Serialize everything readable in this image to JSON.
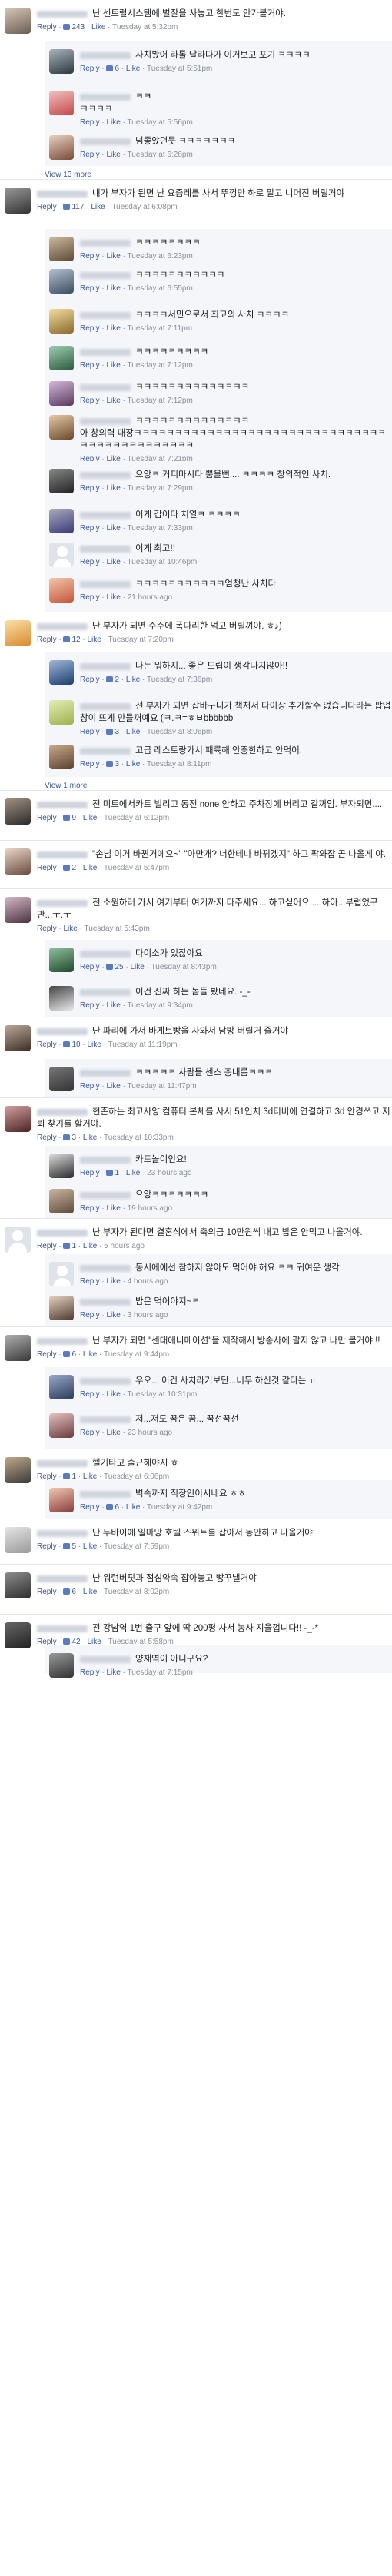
{
  "comments": [
    {
      "level": 0,
      "text": "난 센트럴시스템에 별잘을 사놓고 한번도 안가볼거야.",
      "likes": "243",
      "time": "Tuesday at 5:32pm",
      "h": 54,
      "av": [
        "#6b5d55",
        "#d8c7b5"
      ]
    },
    {
      "level": 1,
      "text": "사치봤어 라톨 달라다가 이거보고 포기 ㅋㅋㅋㅋ",
      "likes": "6",
      "time": "Tuesday at 5:51pm",
      "h": 54,
      "av": [
        "#2c3740",
        "#a8b3ba"
      ]
    },
    {
      "level": 1,
      "text": "ㅋㅋ\nㅋㅋㅋㅋ",
      "likes": "",
      "time": "Tuesday at 5:56pm",
      "h": 58,
      "av": [
        "#c44a4a",
        "#f0c0c0"
      ]
    },
    {
      "level": 1,
      "text": "넘좋았던뭇 ㅋㅋㅋㅋㅋㅋㅋ",
      "likes": "",
      "time": "Tuesday at 6:26pm",
      "h": 50,
      "av": [
        "#7a4b3a",
        "#e8d0c0"
      ]
    },
    {
      "type": "more",
      "text": "View 13 more"
    },
    {
      "level": 0,
      "text": "내가 부자가 된면 난 요즘레를 사서 뚜껑만 하로 말고 니머진 버릴거야",
      "likes": "117",
      "time": "Tuesday at 6:08pm",
      "h": 64,
      "av": [
        "#333",
        "#999"
      ]
    },
    {
      "level": 1,
      "text": "ㅋㅋㅋㅋㅋㅋㅋㅋ",
      "likes": "",
      "time": "Tuesday at 6:23pm",
      "h": 42,
      "av": [
        "#5c4a38",
        "#cdb99c"
      ]
    },
    {
      "level": 1,
      "text": "ㅋㅋㅋㅋㅋㅋㅋㅋㅋㅋㅋ",
      "likes": "",
      "time": "Tuesday at 6:55pm",
      "h": 52,
      "av": [
        "#3d4f63",
        "#b2c0cf"
      ]
    },
    {
      "level": 1,
      "text": "ㅋㅋㅋㅋ서민으로서 최고의 사치 ㅋㅋㅋㅋ",
      "likes": "",
      "time": "Tuesday at 7:11pm",
      "h": 48,
      "av": [
        "#8a6b2d",
        "#f2dca0"
      ]
    },
    {
      "level": 1,
      "text": "ㅋㅋㅋㅋㅋㅋㅋㅋㅋ",
      "likes": "",
      "time": "Tuesday at 7:12pm",
      "h": 46,
      "av": [
        "#2d5a3f",
        "#9dcfb0"
      ]
    },
    {
      "level": 1,
      "text": "ㅋㅋㅋㅋㅋㅋㅋㅋㅋㅋㅋㅋㅋㅋ",
      "likes": "",
      "time": "Tuesday at 7:12pm",
      "h": 44,
      "av": [
        "#5a3a5e",
        "#d4b8d8"
      ]
    },
    {
      "level": 1,
      "text": "ㅋㅋㅋㅋㅋㅋㅋㅋㅋㅋㅋㅋㅋㅋ\n아 창의력 대장ㅋㅋㅋㅋㅋㅋㅋㅋㅋㅋㅋㅋㅋㅋㅋㅋㅋㅋㅋㅋㅋㅋㅋㅋㅋㅋㅋㅋㅋㅋㅋㅋㅋㅋㅋㅋㅋㅋㅋㅋㅋㅋㅋㅋㅋ",
      "likes": "",
      "time": "Tuesday at 7:21pm",
      "h": 70,
      "av": [
        "#6b4a2c",
        "#e5c9a8"
      ]
    },
    {
      "level": 1,
      "text": "으앙ㅋ 커피마시다 뿜을뻔.... ㅋㅋㅋㅋ 창의적인 사치.",
      "likes": "",
      "time": "Tuesday at 7:29pm",
      "h": 52,
      "av": [
        "#222",
        "#888"
      ]
    },
    {
      "level": 1,
      "text": "이게 갑이다 치열ㅋ ㅋㅋㅋㅋ",
      "likes": "",
      "time": "Tuesday at 7:33pm",
      "h": 44,
      "av": [
        "#3a3a7a",
        "#aab"
      ]
    },
    {
      "level": 1,
      "text": "이게 최고!!",
      "likes": "",
      "time": "Tuesday at 10:46pm",
      "h": 46,
      "av": [],
      "ph": true
    },
    {
      "level": 1,
      "text": "ㅋㅋㅋㅋㅋㅋㅋㅋㅋㅋㅋ엄청난 사치다",
      "likes": "",
      "time": "21 hours ago",
      "h": 54,
      "av": [
        "#c4563d",
        "#f3c6a8"
      ]
    },
    {
      "level": 0,
      "text": "난 부자가 되면 주주에 폭다리한 먹고 버릴껴야. ㅎ♪)",
      "likes": "12",
      "time": "Tuesday at 7:20pm",
      "h": 52,
      "av": [
        "#d68a2d",
        "#fbe0a8"
      ]
    },
    {
      "level": 1,
      "text": "나는 뭐하지... 좋은 드립이 생각나지않아!!",
      "likes": "2",
      "time": "Tuesday at 7:36pm",
      "h": 52,
      "av": [
        "#1c3d6e",
        "#a0b8da"
      ]
    },
    {
      "level": 1,
      "text": "전 부자가 되면 잡바구니가 책처서 다이상 추가할수 없습니다라는 팝업창이 뜨게 만들꺼예요 (ㅋ.ㅋ=ㅎㅂbbbbbb",
      "likes": "3",
      "time": "Tuesday at 8:06pm",
      "h": 58,
      "av": [
        "#9fb24a",
        "#e3ecb8"
      ]
    },
    {
      "level": 1,
      "text": "고급 레스토랑가서 패륙해 안중한하고 안먹어.",
      "likes": "3",
      "time": "Tuesday at 8:11pm",
      "h": 52,
      "av": [
        "#5a4030",
        "#c9aa8a"
      ]
    },
    {
      "type": "more",
      "text": "View 1 more"
    },
    {
      "level": 0,
      "text": "전 미트에서카트 빌리고 동전 none 안하고 주차장에 버리고 갈꺼임. 부자되면....",
      "likes": "9",
      "time": "Tuesday at 6:12pm",
      "h": 64,
      "av": [
        "#2b2b2b",
        "#a19080"
      ]
    },
    {
      "level": 0,
      "text": "\"손님 이거 바뀐거에요~\" \"아만개? 너한테나 바꿔겠지\" 하고 팍와잡 곧 나올게 야.",
      "likes": "2",
      "time": "Tuesday at 5:47pm",
      "h": 62,
      "av": [
        "#6a4d40",
        "#ead6c8"
      ]
    },
    {
      "level": 0,
      "text": "전 소원하러 가서 여기부터 여기까지 다주세요... 하고싶어요.....하아...부럽었구만...ㅜ.ㅜ",
      "likes": "",
      "time": "Tuesday at 5:43pm",
      "h": 66,
      "av": [
        "#4a3340",
        "#d6b8c8"
      ]
    },
    {
      "level": 1,
      "text": "다이소가 있잖아요",
      "likes": "25",
      "time": "Tuesday at 8:43pm",
      "h": 50,
      "av": [
        "#1f4a2c",
        "#90c0a0"
      ]
    },
    {
      "level": 1,
      "text": "이건 진짜 하는 놈들 봤네요. -_-",
      "likes": "",
      "time": "Tuesday at 9:34pm",
      "h": 50,
      "av": [
        "#e8e8e8",
        "#444"
      ]
    },
    {
      "level": 0,
      "text": "난 파리에 가서 바게트빵을 사와서 남방 버릴거 즐거야",
      "likes": "10",
      "time": "Tuesday at 11:19pm",
      "h": 54,
      "av": [
        "#3c2e24",
        "#bca89a"
      ]
    },
    {
      "level": 1,
      "text": "ㅋㅋㅋㅋㅋ 사람들 센스 충내름ㅋㅋㅋ",
      "likes": "",
      "time": "Tuesday at 11:47pm",
      "h": 50,
      "av": [
        "#333",
        "#777"
      ]
    },
    {
      "level": 0,
      "text": "현존하는 최고사양 컴퓨터 본체를 사서 51인치 3d티비에 연결하고 3d 안경쓰고 지뢰 찾기를 할거야.",
      "likes": "3",
      "time": "Tuesday at 10:33pm",
      "h": 62,
      "av": [
        "#4d2323",
        "#d0a0a0"
      ]
    },
    {
      "level": 1,
      "text": "카드놀이인요!",
      "likes": "1",
      "time": "23 hours ago",
      "h": 46,
      "av": [
        "#2a2a2a",
        "#ddd"
      ]
    },
    {
      "level": 1,
      "text": "으앙ㅋㅋㅋㅋㅋㅋㅋ",
      "likes": "",
      "time": "19 hours ago",
      "h": 48,
      "av": [
        "#5e4a3a",
        "#cab7a0"
      ]
    },
    {
      "level": 0,
      "text": "난 부자가 된다면 결혼식에서 축의금 10만원씩 내고 밥은 안먹고 나올거야.",
      "likes": "1",
      "time": "5 hours ago",
      "h": 46,
      "av": [],
      "ph": true
    },
    {
      "level": 1,
      "text": "동시에에선 참하지 않아도 먹어야 해요 ㅋㅋ 귀여운 생각",
      "likes": "",
      "time": "4 hours ago",
      "h": 44,
      "av": [],
      "ph": true
    },
    {
      "level": 1,
      "text": "밥은 먹어야지~ㅋ",
      "likes": "",
      "time": "3 hours ago",
      "h": 50,
      "av": [
        "#4d3a2e",
        "#e8d3c0"
      ]
    },
    {
      "level": 0,
      "text": "난 부자가 되면 \"센대애니메이션\"을 제작해서 방송사에 팔지 않고 나만 볼거야!!!",
      "likes": "6",
      "time": "Tuesday at 9:44pm",
      "h": 52,
      "av": [
        "#383838",
        "#b0b0b0"
      ]
    },
    {
      "level": 1,
      "text": "우오... 이건 사치라기보단...너무 하신것 같다는 ㅠ",
      "likes": "",
      "time": "Tuesday at 10:31pm",
      "h": 50,
      "av": [
        "#2a3a5a",
        "#98a8c8"
      ]
    },
    {
      "level": 1,
      "text": "저...저도 꿈은 꿈... 꿈선꿈선",
      "likes": "",
      "time": "23 hours ago",
      "h": 56,
      "av": [
        "#6b3c3c",
        "#e6c0c0"
      ]
    },
    {
      "level": 0,
      "text": "헬기타고 출근해야지 ㅎ",
      "likes": "1",
      "time": "Tuesday at 6:06pm",
      "h": 40,
      "av": [
        "#3a3a3a",
        "#c0a888"
      ]
    },
    {
      "level": 1,
      "text": "벽속까지 직장인이시네요 ㅎㅎ",
      "likes": "6",
      "time": "Tuesday at 9:42pm",
      "h": 50,
      "av": [
        "#8a3d3d",
        "#f0c8b0"
      ]
    },
    {
      "level": 0,
      "text": "난 두바이에 일마망 호텔 스위트를 잡아서 동안하고 나올거야",
      "likes": "5",
      "time": "Tuesday at 7:59pm",
      "h": 58,
      "av": [
        "#9a9a9a",
        "#e5e5e5"
      ]
    },
    {
      "level": 0,
      "text": "난 워런버핏과 점심약속 잡아놓고 빵꾸낼거야",
      "likes": "6",
      "time": "Tuesday at 8:02pm",
      "h": 64,
      "av": [
        "#2e2e2e",
        "#8c8c8c"
      ]
    },
    {
      "level": 0,
      "text": "전 강남역 1번 출구 앞에 딱 200평 사서 농사 지을껍니다!! -_-*",
      "likes": "42",
      "time": "Tuesday at 5:58pm",
      "h": 40,
      "av": [
        "#222",
        "#666"
      ]
    },
    {
      "level": 1,
      "text": "양재역이 아니구요?",
      "likes": "",
      "time": "Tuesday at 7:15pm",
      "h": 36,
      "av": [
        "#333",
        "#999"
      ]
    }
  ],
  "labels": {
    "reply": "Reply",
    "like": "Like"
  }
}
